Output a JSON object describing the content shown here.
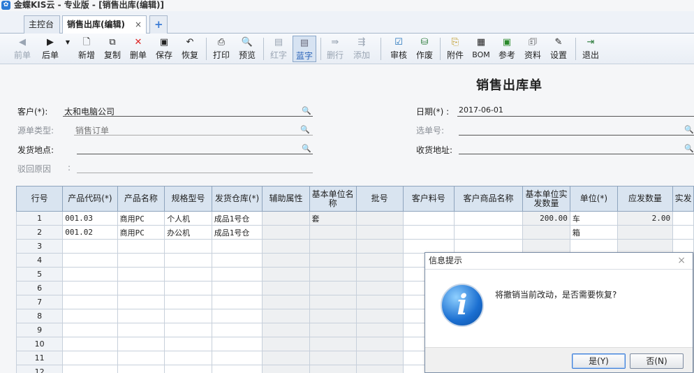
{
  "window": {
    "title": "金蝶KIS云 - 专业版 - [销售出库(编辑)]",
    "logo": "金蝶"
  },
  "tabs": {
    "home": "主控台",
    "active": "销售出库(编辑)",
    "close": "×",
    "add": "+"
  },
  "toolbar": {
    "prev": {
      "label": "前单",
      "icon": "arrow-left-icon"
    },
    "next": {
      "label": "后单",
      "icon": "arrow-right-icon"
    },
    "new": {
      "label": "新增",
      "icon": "new-doc-icon"
    },
    "copy": {
      "label": "复制",
      "icon": "copy-icon"
    },
    "delete": {
      "label": "删单",
      "icon": "delete-x-icon"
    },
    "save": {
      "label": "保存",
      "icon": "save-icon"
    },
    "restore": {
      "label": "恢复",
      "icon": "undo-icon"
    },
    "print": {
      "label": "打印",
      "icon": "printer-icon"
    },
    "preview": {
      "label": "预览",
      "icon": "preview-icon"
    },
    "red": {
      "label": "红字",
      "icon": "red-doc-icon"
    },
    "blue": {
      "label": "蓝字",
      "icon": "blue-doc-icon"
    },
    "delrow": {
      "label": "删行",
      "icon": "delete-row-icon"
    },
    "addrow": {
      "label": "添加",
      "icon": "add-row-icon"
    },
    "audit": {
      "label": "审核",
      "icon": "audit-icon"
    },
    "void": {
      "label": "作废",
      "icon": "void-icon"
    },
    "attach": {
      "label": "附件",
      "icon": "attachment-icon"
    },
    "bom": {
      "label": "BOM",
      "icon": "bom-icon"
    },
    "ref": {
      "label": "参考",
      "icon": "reference-icon"
    },
    "info": {
      "label": "资料",
      "icon": "info-icon"
    },
    "settings": {
      "label": "设置",
      "icon": "settings-icon"
    },
    "exit": {
      "label": "退出",
      "icon": "exit-icon"
    }
  },
  "form": {
    "title": "销售出库单",
    "customer": {
      "label": "客户(*):",
      "value": "太和电脑公司"
    },
    "source_type": {
      "label": "源单类型:",
      "value": "销售订单"
    },
    "ship_location": {
      "label": "发货地点:",
      "value": ""
    },
    "reject_reason": {
      "label": "驳回原因",
      "sep": ":",
      "value": ""
    },
    "date": {
      "label": "日期(*) :",
      "value": "2017-06-01"
    },
    "select_no": {
      "label": "选单号:",
      "value": ""
    },
    "recv_address": {
      "label": "收货地址:",
      "value": ""
    }
  },
  "grid": {
    "columns": [
      "行号",
      "产品代码(*)",
      "产品名称",
      "规格型号",
      "发货仓库(*)",
      "辅助属性",
      "基本单位名称",
      "批号",
      "客户料号",
      "客户商品名称",
      "基本单位实发数量",
      "单位(*)",
      "应发数量",
      "实发"
    ],
    "rows": [
      [
        "1",
        "001.03",
        "商用PC",
        "个人机",
        "成品1号仓",
        "",
        "套",
        "",
        "",
        "",
        "200.00",
        "车",
        "2.00",
        ""
      ],
      [
        "2",
        "001.02",
        "商用PC",
        "办公机",
        "成品1号仓",
        "",
        "",
        "",
        "",
        "",
        "",
        "箱",
        "",
        ""
      ],
      [
        "3",
        "",
        "",
        "",
        "",
        "",
        "",
        "",
        "",
        "",
        "",
        "",
        "",
        ""
      ],
      [
        "4",
        "",
        "",
        "",
        "",
        "",
        "",
        "",
        "",
        "",
        "",
        "",
        "",
        ""
      ],
      [
        "5",
        "",
        "",
        "",
        "",
        "",
        "",
        "",
        "",
        "",
        "",
        "",
        "",
        ""
      ],
      [
        "6",
        "",
        "",
        "",
        "",
        "",
        "",
        "",
        "",
        "",
        "",
        "",
        "",
        ""
      ],
      [
        "7",
        "",
        "",
        "",
        "",
        "",
        "",
        "",
        "",
        "",
        "",
        "",
        "",
        ""
      ],
      [
        "8",
        "",
        "",
        "",
        "",
        "",
        "",
        "",
        "",
        "",
        "",
        "",
        "",
        ""
      ],
      [
        "9",
        "",
        "",
        "",
        "",
        "",
        "",
        "",
        "",
        "",
        "",
        "",
        "",
        ""
      ],
      [
        "10",
        "",
        "",
        "",
        "",
        "",
        "",
        "",
        "",
        "",
        "",
        "",
        "",
        ""
      ],
      [
        "11",
        "",
        "",
        "",
        "",
        "",
        "",
        "",
        "",
        "",
        "",
        "",
        "",
        ""
      ],
      [
        "12",
        "",
        "",
        "",
        "",
        "",
        "",
        "",
        "",
        "",
        "",
        "",
        "",
        ""
      ]
    ]
  },
  "dialog": {
    "title": "信息提示",
    "close": "×",
    "icon": "i",
    "message": "将撤销当前改动，是否需要恢复?",
    "yes": "是(Y)",
    "no": "否(N)"
  }
}
